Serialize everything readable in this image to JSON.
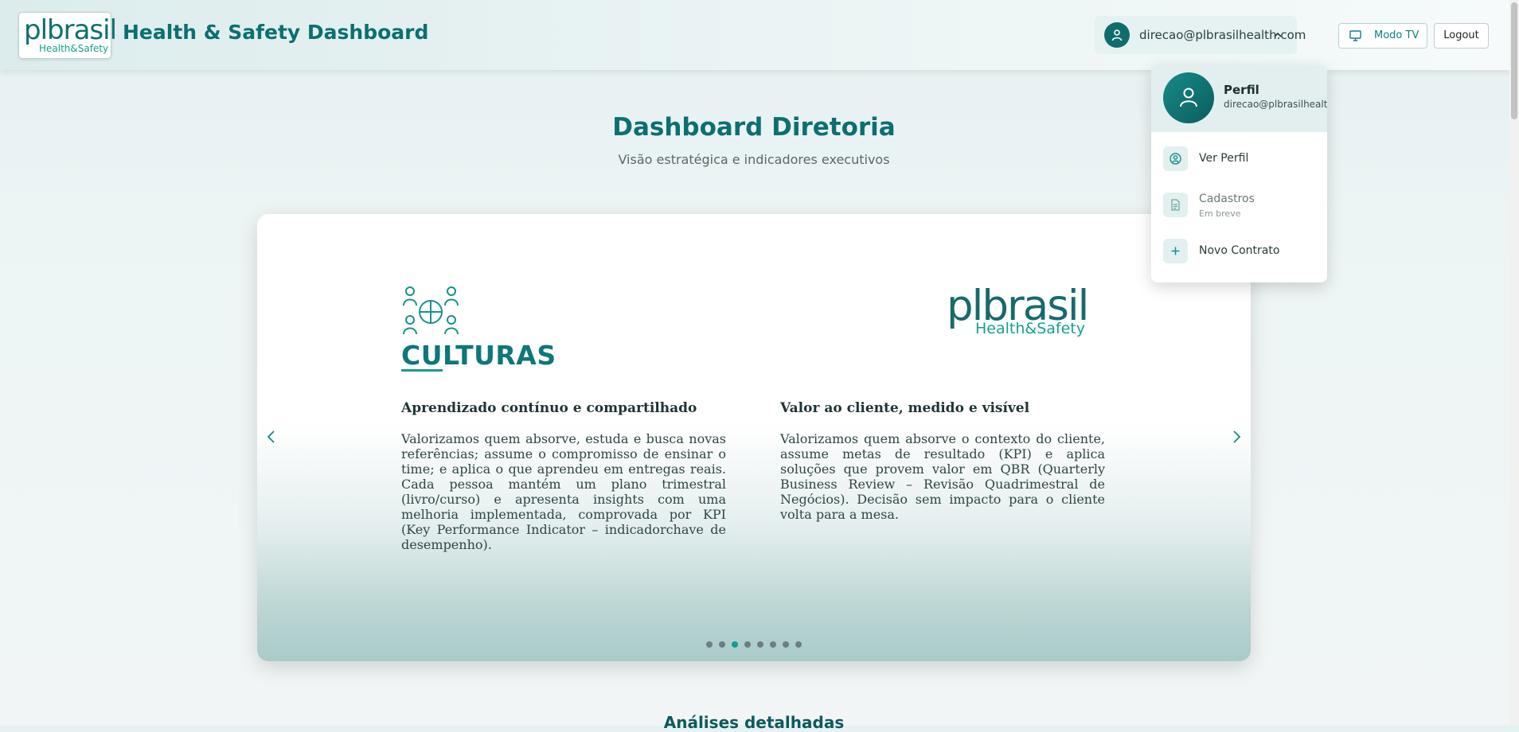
{
  "header": {
    "logo_wordmark": "plbrasil",
    "logo_tagline": "Health&Safety",
    "app_title": "Health & Safety Dashboard",
    "user_email": "direcao@plbrasilhealth.com",
    "tv_button": "Modo TV",
    "logout_button": "Logout"
  },
  "main": {
    "title": "Dashboard Diretoria",
    "subtitle": "Visão estratégica e indicadores executivos",
    "next_section_heading": "Análises detalhadas"
  },
  "carousel": {
    "slide_title": "CULTURAS",
    "brand_wordmark": "plbrasil",
    "brand_tagline": "Health&Safety",
    "left_heading": "Aprendizado contínuo e compartilhado",
    "left_body": "Valorizamos quem absorve, estuda e busca novas referências; assume o compromisso de ensinar o time; e aplica o que aprendeu em entregas reais. Cada pessoa mantém um plano trimestral (livro/curso) e apresenta insights com uma melhoria implementada, comprovada por KPI (Key Performance Indicator – indicadorchave de desempenho).",
    "right_heading": "Valor ao cliente, medido e visível",
    "right_body": "Valorizamos quem absorve o contexto do cliente, assume metas de resultado (KPI) e aplica soluções que provem valor em QBR (Quarterly Business Review – Revisão Quadrimestral de Negócios). Decisão sem impacto para o cliente volta para a mesa.",
    "slide_count": 8,
    "active_slide_index": 2
  },
  "user_menu": {
    "name": "Perfil",
    "email": "direcao@plbrasilhealth.com",
    "items": [
      {
        "label": "Ver Perfil",
        "icon": "user-circle-icon"
      },
      {
        "label": "Cadastros",
        "sublabel": "Em breve",
        "icon": "document-icon",
        "disabled": true
      },
      {
        "label": "Novo Contrato",
        "icon": "plus-icon"
      }
    ]
  },
  "colors": {
    "primary": "#0d6f6f",
    "accent": "#129d92",
    "dot_inactive": "#6c7f80"
  }
}
